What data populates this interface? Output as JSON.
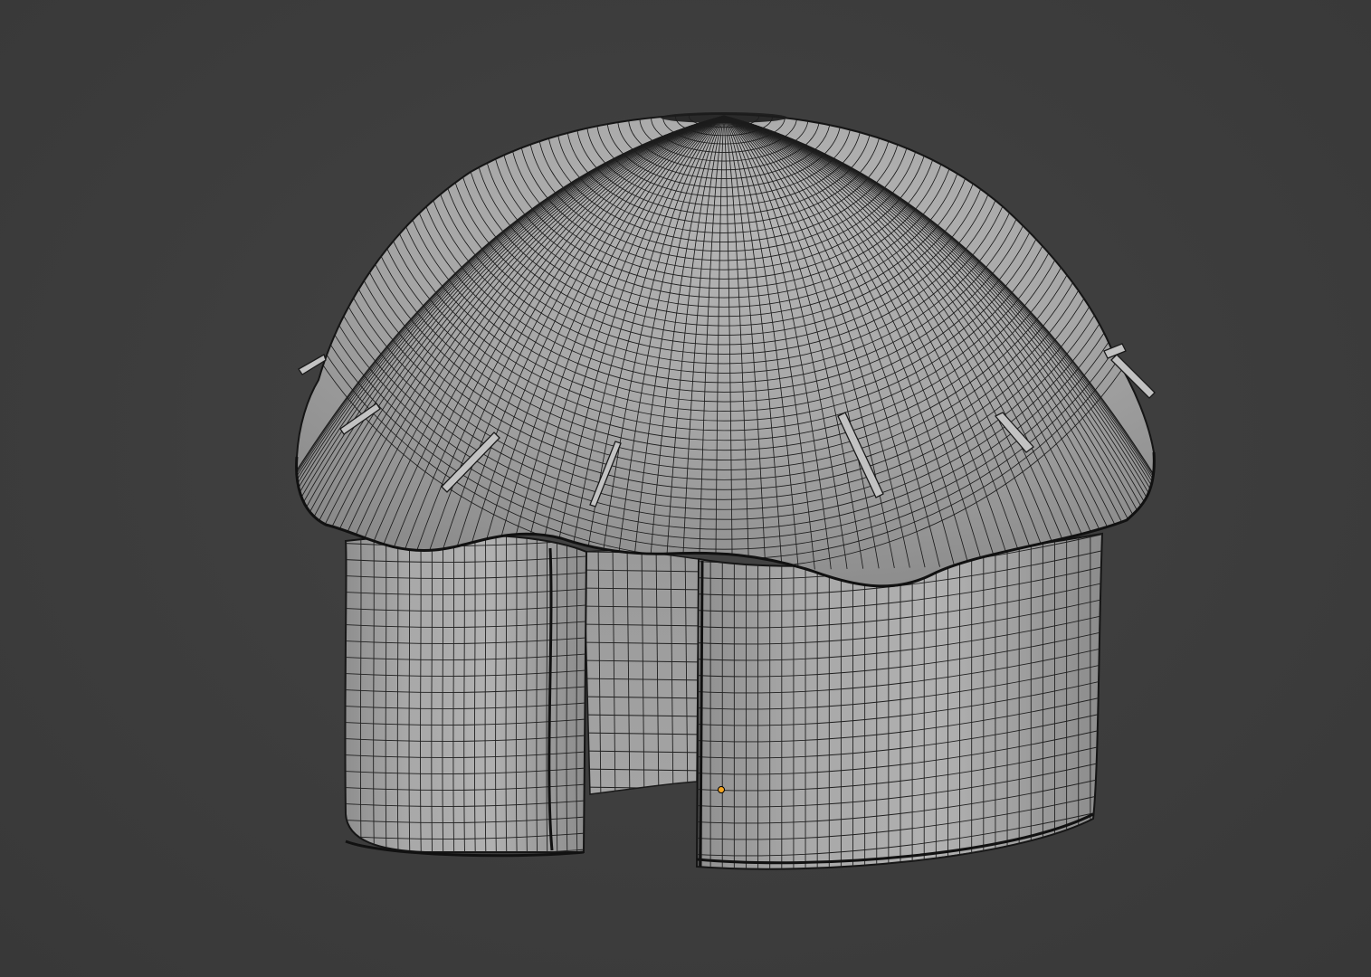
{
  "viewport": {
    "background_color": "#3d3d3d",
    "mesh_fill_color": "#a9a9a9",
    "wire_color": "#1a1a1a",
    "origin_marker_color": "#f5a623",
    "shading": "solid",
    "overlay": "wireframe"
  },
  "scene_object": {
    "description_icon": "mesh-object-icon",
    "selected": false
  }
}
